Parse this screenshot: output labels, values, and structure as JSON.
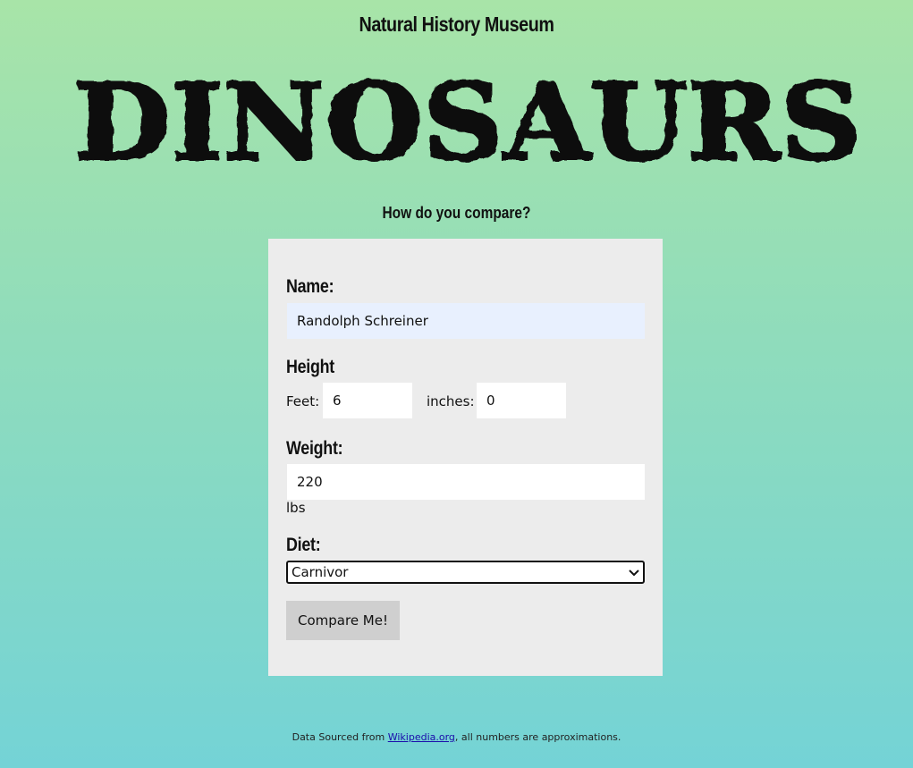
{
  "header": {
    "museum_title": "Natural History Museum",
    "banner_text": "DINOSAURS",
    "subtitle": "How do you compare?"
  },
  "form": {
    "name_label": "Name:",
    "name_value": "Randolph Schreiner",
    "height_label": "Height",
    "feet_label": "Feet:",
    "feet_value": "6",
    "inches_label": "inches:",
    "inches_value": "0",
    "weight_label": "Weight:",
    "weight_value": "220",
    "weight_unit": "lbs",
    "diet_label": "Diet:",
    "diet_selected": "Carnivor",
    "submit_label": "Compare Me!"
  },
  "footer": {
    "prefix": "Data Sourced from ",
    "link_text": "Wikipedia.org",
    "suffix": ", all numbers are approximations."
  },
  "colors": {
    "gradient_top": "#a8e4a8",
    "gradient_bottom": "#74d3d6",
    "card_bg": "#ececec",
    "name_input_bg": "#e8f0fe",
    "button_bg": "#cfcfcf"
  }
}
